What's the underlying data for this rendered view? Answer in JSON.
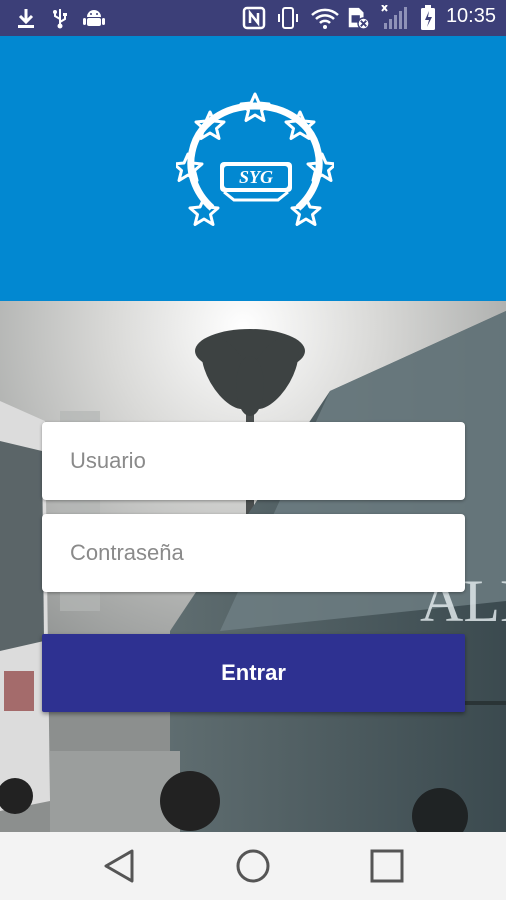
{
  "status_bar": {
    "time": "10:35",
    "icons": [
      "download-icon",
      "usb-icon",
      "android-debug-icon",
      "nfc-icon",
      "vibrate-icon",
      "wifi-icon",
      "sim-icon",
      "signal-icon",
      "battery-icon"
    ]
  },
  "header": {
    "logo_text": "SYG",
    "background_color": "#0288d1"
  },
  "login_form": {
    "username_placeholder": "Usuario",
    "password_placeholder": "Contraseña",
    "submit_label": "Entrar",
    "button_color": "#2e3191"
  },
  "background_text": "ALE",
  "nav_bar": {
    "buttons": [
      "back-icon",
      "home-icon",
      "recents-icon"
    ]
  }
}
